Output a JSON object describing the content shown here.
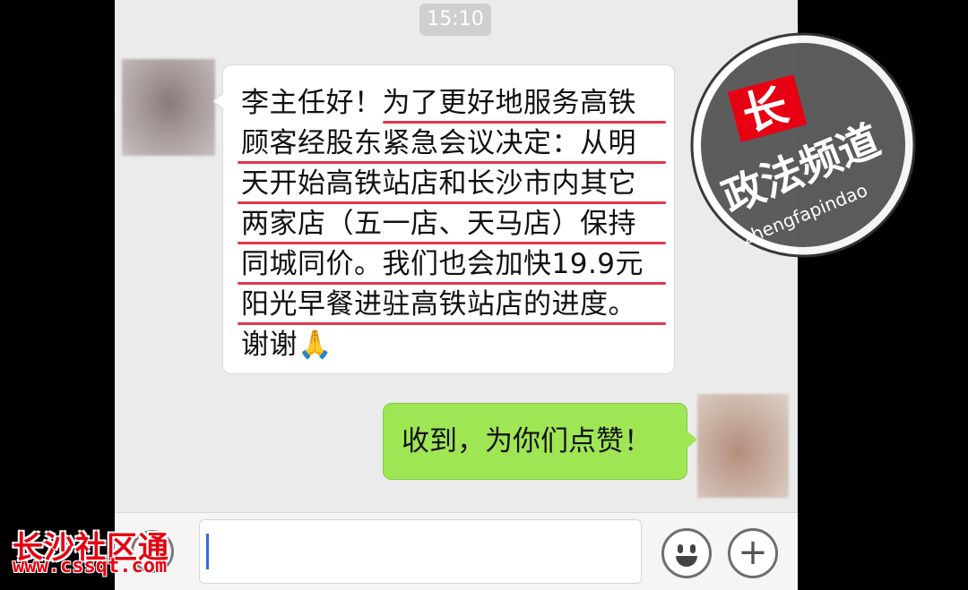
{
  "chat": {
    "timestamp": "15:10",
    "incoming_message": {
      "lines": [
        "李主任好！为了更好地服务高铁",
        "顾客经股东紧急会议决定：从明",
        "天开始高铁站店和长沙市内其它",
        "两家店（五一店、天马店）保持",
        "同城同价。我们也会加快19.9元",
        "阳光早餐进驻高铁站店的进度。",
        "谢谢🙏"
      ],
      "underline_color": "#e0364c"
    },
    "outgoing_message": "收到，为你们点赞！"
  },
  "input_bar": {
    "voice_icon": "voice-icon",
    "emoji_icon": "emoji-icon",
    "plus_icon": "plus-icon",
    "plus_glyph": "+"
  },
  "watermark": {
    "logo_char": "长",
    "channel_name": "政法频道",
    "channel_pinyin": "zhengfapindao",
    "site_name": "长沙社区通",
    "site_url": "www.cssqt.com"
  },
  "colors": {
    "bubble_outgoing": "#9fe655",
    "chat_background": "#ebebeb",
    "watermark_red": "#e60012"
  }
}
